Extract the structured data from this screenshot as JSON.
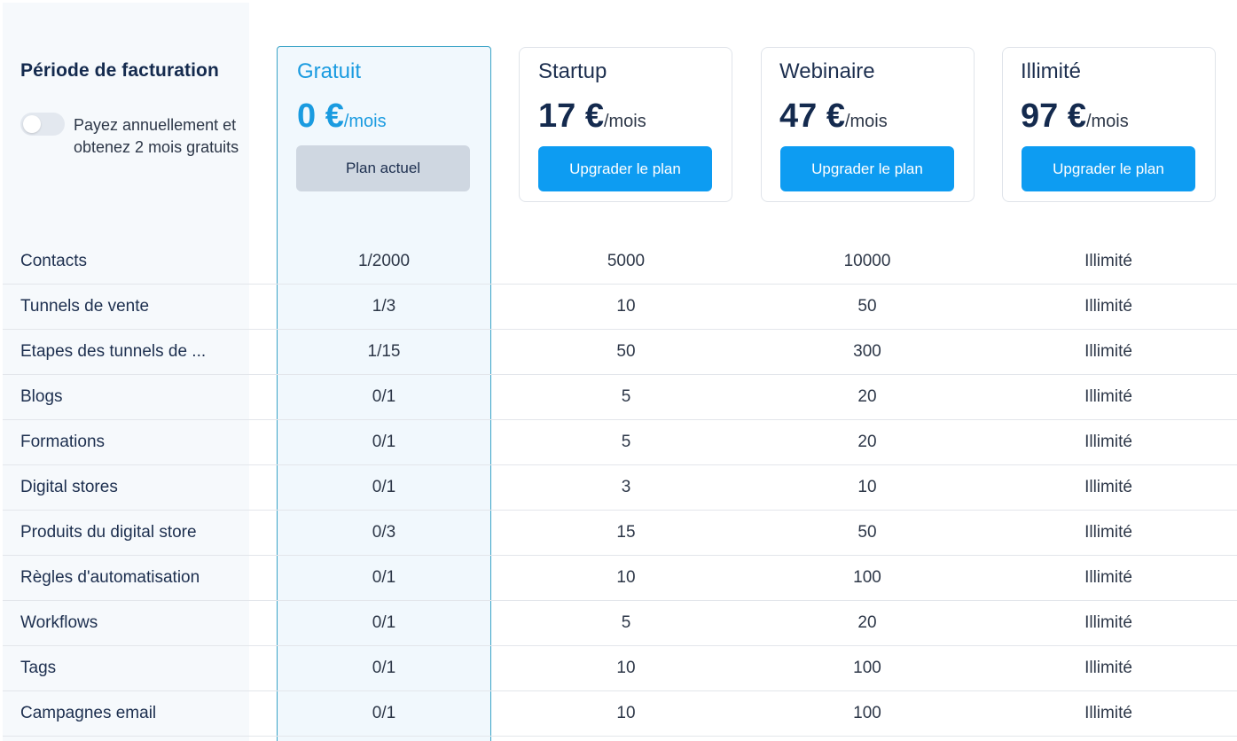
{
  "billing": {
    "title": "Période de facturation",
    "toggle_label": "Payez annuellement et obtenez 2 mois gratuits",
    "annual_enabled": false
  },
  "plans": [
    {
      "name": "Gratuit",
      "amount": "0 €",
      "per": "/mois",
      "button": "Plan actuel",
      "current": true
    },
    {
      "name": "Startup",
      "amount": "17 €",
      "per": "/mois",
      "button": "Upgrader le plan",
      "current": false
    },
    {
      "name": "Webinaire",
      "amount": "47 €",
      "per": "/mois",
      "button": "Upgrader le plan",
      "current": false
    },
    {
      "name": "Illimité",
      "amount": "97 €",
      "per": "/mois",
      "button": "Upgrader le plan",
      "current": false
    }
  ],
  "features": [
    {
      "label": "Contacts",
      "values": [
        "1/2000",
        "5000",
        "10000",
        "Illimité"
      ]
    },
    {
      "label": "Tunnels de vente",
      "values": [
        "1/3",
        "10",
        "50",
        "Illimité"
      ]
    },
    {
      "label": "Etapes des tunnels de ...",
      "values": [
        "1/15",
        "50",
        "300",
        "Illimité"
      ]
    },
    {
      "label": "Blogs",
      "values": [
        "0/1",
        "5",
        "20",
        "Illimité"
      ]
    },
    {
      "label": "Formations",
      "values": [
        "0/1",
        "5",
        "20",
        "Illimité"
      ]
    },
    {
      "label": "Digital stores",
      "values": [
        "0/1",
        "3",
        "10",
        "Illimité"
      ]
    },
    {
      "label": "Produits du digital store",
      "values": [
        "0/3",
        "15",
        "50",
        "Illimité"
      ]
    },
    {
      "label": "Règles d'automatisation",
      "values": [
        "0/1",
        "10",
        "100",
        "Illimité"
      ]
    },
    {
      "label": "Workflows",
      "values": [
        "0/1",
        "5",
        "20",
        "Illimité"
      ]
    },
    {
      "label": "Tags",
      "values": [
        "0/1",
        "10",
        "100",
        "Illimité"
      ]
    },
    {
      "label": "Campagnes email",
      "values": [
        "0/1",
        "10",
        "100",
        "Illimité"
      ]
    }
  ],
  "colors": {
    "accent": "#0d9cf2",
    "free_accent": "#1a9be0",
    "heading": "#142a4e"
  }
}
